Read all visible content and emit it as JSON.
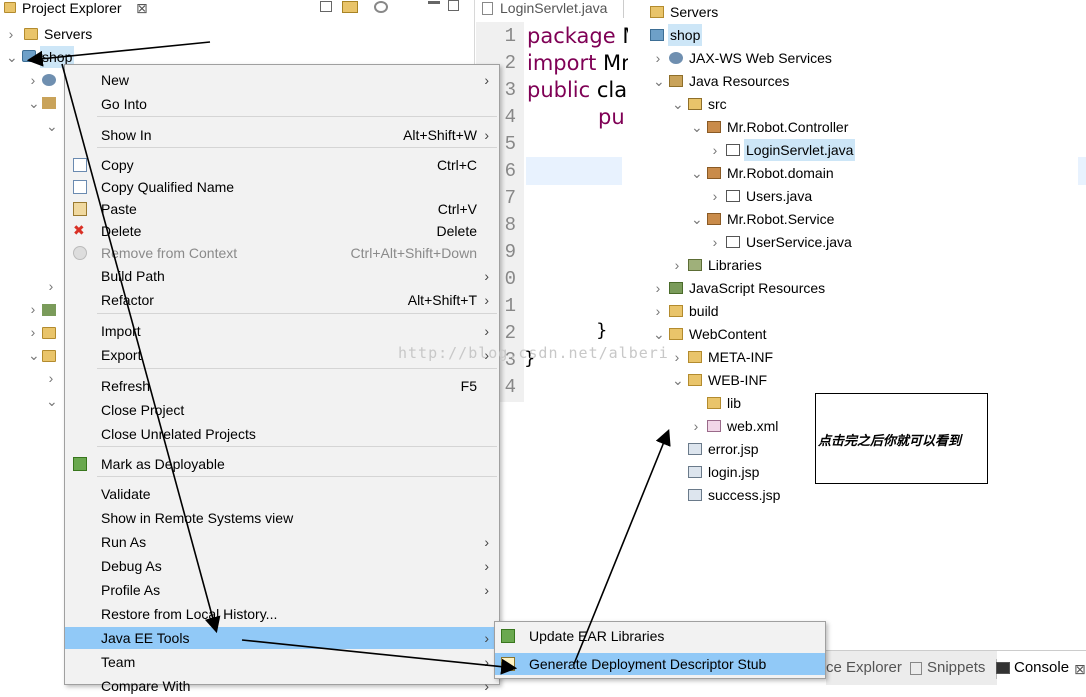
{
  "project_explorer": {
    "title": "Project Explorer",
    "close_glyph": "⊠",
    "rows": [
      {
        "label": "Servers",
        "icon": "folder-icon"
      },
      {
        "label": "shop",
        "icon": "project-icon",
        "selected": true
      }
    ]
  },
  "editor": {
    "tab_label": "LoginServlet.java",
    "line_numbers": [
      "1",
      "2",
      "3",
      "4",
      "5",
      "6",
      "7",
      "8",
      "9",
      "0",
      "1",
      "2",
      "3",
      "4"
    ],
    "code_lines": [
      {
        "kw": "package",
        "rest": " M"
      },
      {
        "kw": "import",
        "rest": " Mr"
      },
      {
        "kw": "public",
        "rest": " clas"
      },
      {
        "kw": "",
        "rest": "pu"
      },
      {
        "kw": "",
        "rest": "}"
      },
      {
        "kw": "",
        "rest": "}"
      }
    ]
  },
  "context_menu": {
    "items": [
      {
        "label": "New",
        "accel": "",
        "submenu": true,
        "icon": ""
      },
      {
        "label": "Go Into",
        "accel": "",
        "submenu": false,
        "icon": ""
      },
      {
        "label": "Show In",
        "accel": "Alt+Shift+W",
        "submenu": true,
        "icon": ""
      },
      {
        "label": "Copy",
        "accel": "Ctrl+C",
        "submenu": false,
        "icon": "copy-icon"
      },
      {
        "label": "Copy Qualified Name",
        "accel": "",
        "submenu": false,
        "icon": "copy-qualified-icon"
      },
      {
        "label": "Paste",
        "accel": "Ctrl+V",
        "submenu": false,
        "icon": "paste-icon"
      },
      {
        "label": "Delete",
        "accel": "Delete",
        "submenu": false,
        "icon": "delete-icon"
      },
      {
        "label": "Remove from Context",
        "accel": "Ctrl+Alt+Shift+Down",
        "submenu": false,
        "icon": "remove-context-icon",
        "disabled": true
      },
      {
        "label": "Build Path",
        "accel": "",
        "submenu": true,
        "icon": ""
      },
      {
        "label": "Refactor",
        "accel": "Alt+Shift+T",
        "submenu": true,
        "icon": ""
      },
      {
        "label": "Import",
        "accel": "",
        "submenu": true,
        "icon": ""
      },
      {
        "label": "Export",
        "accel": "",
        "submenu": true,
        "icon": ""
      },
      {
        "label": "Refresh",
        "accel": "F5",
        "submenu": false,
        "icon": ""
      },
      {
        "label": "Close Project",
        "accel": "",
        "submenu": false,
        "icon": ""
      },
      {
        "label": "Close Unrelated Projects",
        "accel": "",
        "submenu": false,
        "icon": ""
      },
      {
        "label": "Mark as Deployable",
        "accel": "",
        "submenu": false,
        "icon": "deployable-icon"
      },
      {
        "label": "Validate",
        "accel": "",
        "submenu": false,
        "icon": ""
      },
      {
        "label": "Show in Remote Systems view",
        "accel": "",
        "submenu": false,
        "icon": ""
      },
      {
        "label": "Run As",
        "accel": "",
        "submenu": true,
        "icon": ""
      },
      {
        "label": "Debug As",
        "accel": "",
        "submenu": true,
        "icon": ""
      },
      {
        "label": "Profile As",
        "accel": "",
        "submenu": true,
        "icon": ""
      },
      {
        "label": "Restore from Local History...",
        "accel": "",
        "submenu": false,
        "icon": ""
      },
      {
        "label": "Java EE Tools",
        "accel": "",
        "submenu": true,
        "icon": "",
        "highlighted": true
      },
      {
        "label": "Team",
        "accel": "",
        "submenu": true,
        "icon": ""
      },
      {
        "label": "Compare With",
        "accel": "",
        "submenu": true,
        "icon": ""
      }
    ],
    "submenu_glyph": "›"
  },
  "submenu": {
    "items": [
      {
        "label": "Update EAR Libraries",
        "icon": "ear-libraries-icon"
      },
      {
        "label": "Generate Deployment Descriptor Stub",
        "icon": "descriptor-stub-icon",
        "highlighted": true
      }
    ]
  },
  "right_tree": {
    "rows": [
      {
        "label": "Servers",
        "icon": "folder-icon",
        "indent": 0,
        "chev": ""
      },
      {
        "label": "shop",
        "icon": "project-icon",
        "indent": 0,
        "chev": "",
        "selected": true
      },
      {
        "label": "JAX-WS Web Services",
        "icon": "webservice-icon",
        "indent": 1,
        "chev": "›"
      },
      {
        "label": "Java Resources",
        "icon": "java-resources-icon",
        "indent": 1,
        "chev": "⌄"
      },
      {
        "label": "src",
        "icon": "source-folder-icon",
        "indent": 2,
        "chev": "⌄"
      },
      {
        "label": "Mr.Robot.Controller",
        "icon": "package-icon",
        "indent": 3,
        "chev": "⌄"
      },
      {
        "label": "LoginServlet.java",
        "icon": "java-file-icon",
        "indent": 4,
        "chev": "›",
        "selected": true
      },
      {
        "label": "Mr.Robot.domain",
        "icon": "package-icon",
        "indent": 3,
        "chev": "⌄"
      },
      {
        "label": "Users.java",
        "icon": "java-file-icon",
        "indent": 4,
        "chev": "›"
      },
      {
        "label": "Mr.Robot.Service",
        "icon": "package-icon",
        "indent": 3,
        "chev": "⌄"
      },
      {
        "label": "UserService.java",
        "icon": "java-file-icon",
        "indent": 4,
        "chev": "›"
      },
      {
        "label": "Libraries",
        "icon": "libraries-icon",
        "indent": 2,
        "chev": "›"
      },
      {
        "label": "JavaScript Resources",
        "icon": "js-resources-icon",
        "indent": 1,
        "chev": "›"
      },
      {
        "label": "build",
        "icon": "folder-icon",
        "indent": 1,
        "chev": "›"
      },
      {
        "label": "WebContent",
        "icon": "folder-icon",
        "indent": 1,
        "chev": "⌄"
      },
      {
        "label": "META-INF",
        "icon": "folder-icon",
        "indent": 2,
        "chev": "›"
      },
      {
        "label": "WEB-INF",
        "icon": "folder-icon",
        "indent": 2,
        "chev": "⌄"
      },
      {
        "label": "lib",
        "icon": "folder-icon",
        "indent": 3,
        "chev": ""
      },
      {
        "label": "web.xml",
        "icon": "xml-file-icon",
        "indent": 3,
        "chev": "›"
      },
      {
        "label": "error.jsp",
        "icon": "jsp-file-icon",
        "indent": 2,
        "chev": ""
      },
      {
        "label": "login.jsp",
        "icon": "jsp-file-icon",
        "indent": 2,
        "chev": ""
      },
      {
        "label": "success.jsp",
        "icon": "jsp-file-icon",
        "indent": 2,
        "chev": ""
      }
    ]
  },
  "bottom_tabs": [
    {
      "label": "ce Explorer",
      "icon": ""
    },
    {
      "label": "Snippets",
      "icon": "snippets-icon"
    },
    {
      "label": "Console",
      "icon": "console-icon"
    }
  ],
  "annotation": {
    "text": "点击完之后你就可以看到"
  },
  "watermark": "http://blog.csdn.net/alberi"
}
